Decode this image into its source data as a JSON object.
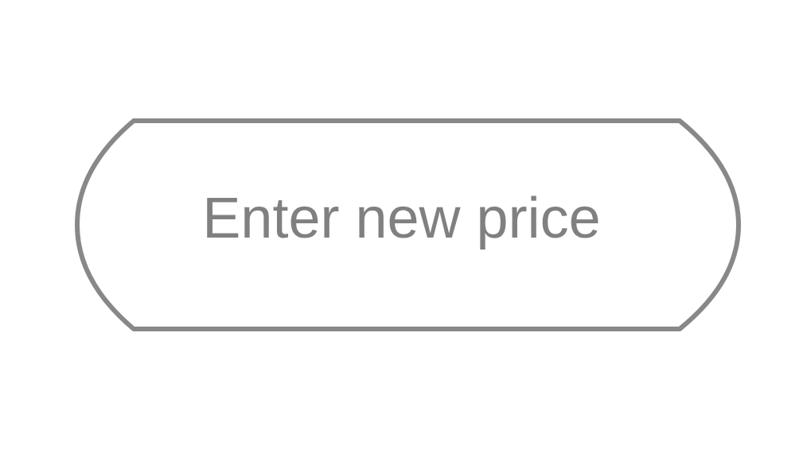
{
  "price_field": {
    "placeholder": "Enter new price",
    "value": ""
  },
  "colors": {
    "outline": "#888888",
    "text": "#808080",
    "background": "#ffffff"
  }
}
